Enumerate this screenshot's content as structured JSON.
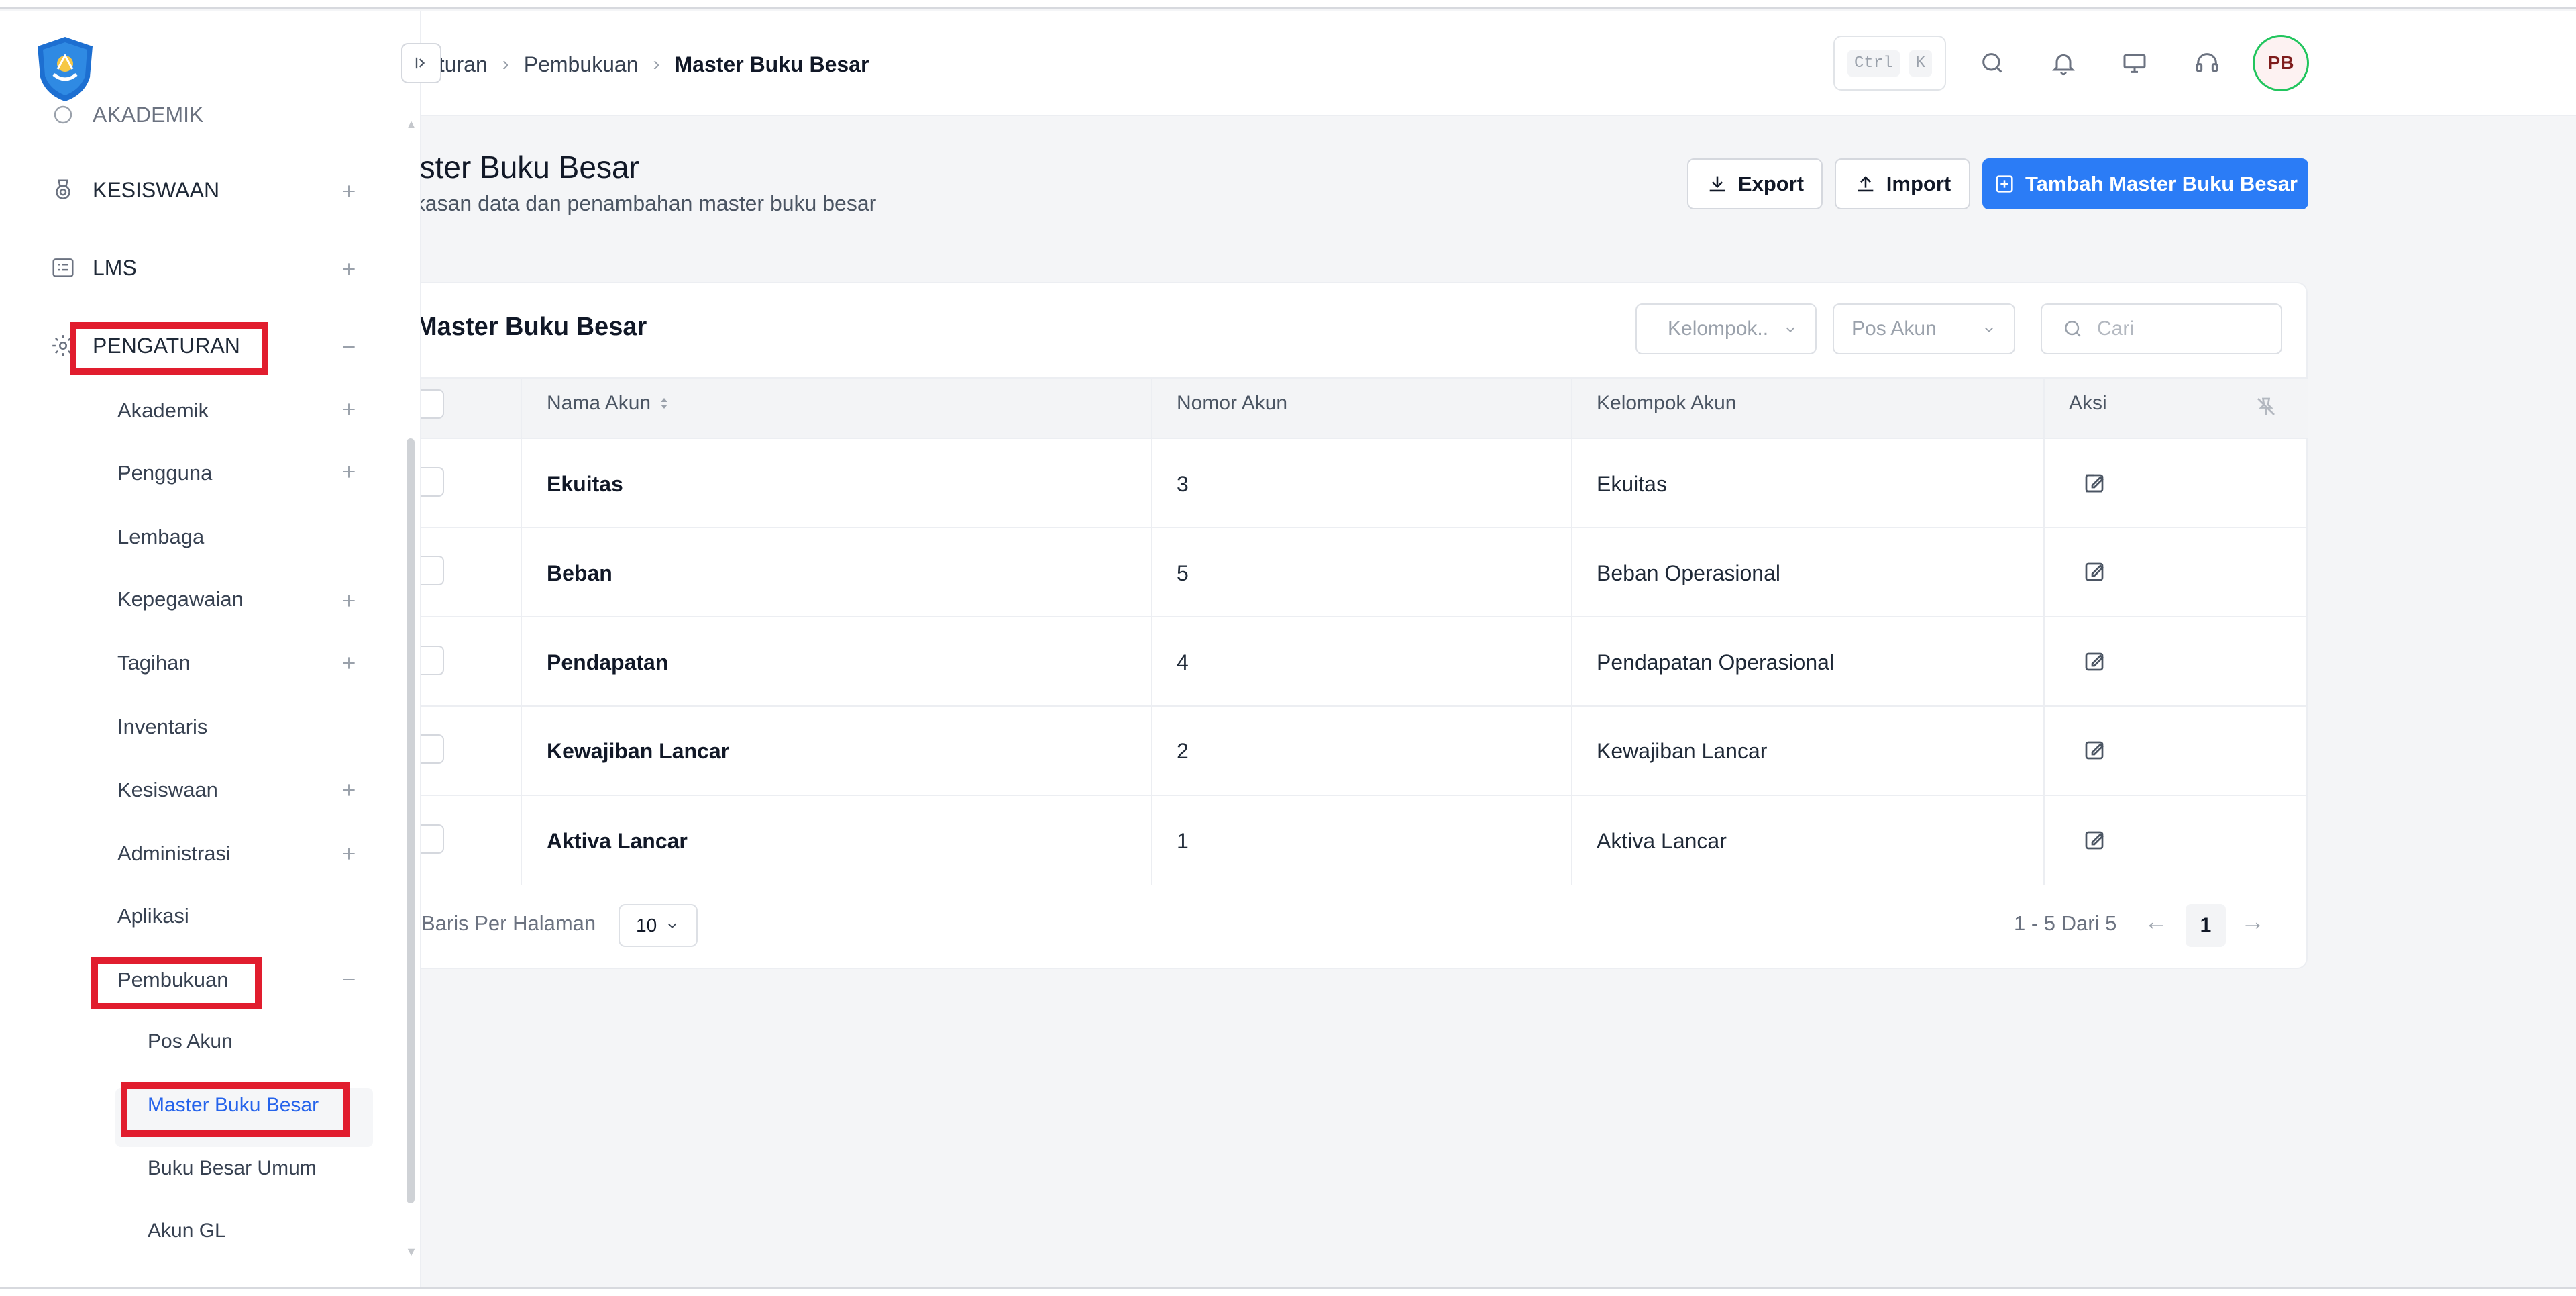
{
  "breadcrumb": {
    "item1": "aturan",
    "item2": "Pembukuan",
    "current": "Master Buku Besar"
  },
  "header": {
    "kbd_ctrl": "Ctrl",
    "kbd_k": "K",
    "avatar_initials": "PB"
  },
  "sidebar": {
    "akademik_partial": "AKADEMIK",
    "kesiswaan": "KESISWAAN",
    "lms": "LMS",
    "pengaturan": "PENGATURAN",
    "sub": {
      "akademik": "Akademik",
      "pengguna": "Pengguna",
      "lembaga": "Lembaga",
      "kepegawaian": "Kepegawaian",
      "tagihan": "Tagihan",
      "inventaris": "Inventaris",
      "kesiswaan": "Kesiswaan",
      "administrasi": "Administrasi",
      "aplikasi": "Aplikasi",
      "pembukuan": "Pembukuan"
    },
    "pembukuan_items": {
      "pos_akun": "Pos Akun",
      "master_buku_besar": "Master Buku Besar",
      "buku_besar_umum": "Buku Besar Umum",
      "akun_gl": "Akun GL"
    }
  },
  "page": {
    "title": "aster Buku Besar",
    "subtitle": "gkasan data dan penambahan master buku besar",
    "export_label": "Export",
    "import_label": "Import",
    "add_label": "Tambah Master Buku Besar"
  },
  "card": {
    "title": "Master Buku Besar",
    "filter_kelompok": "Kelompok..",
    "filter_pos": "Pos Akun",
    "search_placeholder": "Cari"
  },
  "table": {
    "headers": {
      "nama": "Nama Akun",
      "nomor": "Nomor Akun",
      "kelompok": "Kelompok Akun",
      "aksi": "Aksi"
    },
    "rows": [
      {
        "nama": "Ekuitas",
        "nomor": "3",
        "kelompok": "Ekuitas"
      },
      {
        "nama": "Beban",
        "nomor": "5",
        "kelompok": "Beban Operasional"
      },
      {
        "nama": "Pendapatan",
        "nomor": "4",
        "kelompok": "Pendapatan Operasional"
      },
      {
        "nama": "Kewajiban Lancar",
        "nomor": "2",
        "kelompok": "Kewajiban Lancar"
      },
      {
        "nama": "Aktiva Lancar",
        "nomor": "1",
        "kelompok": "Aktiva Lancar"
      }
    ]
  },
  "pagination": {
    "per_page_label": "Baris Per Halaman",
    "per_page_value": "10",
    "range": "1 - 5 Dari 5",
    "current_page": "1"
  },
  "colors": {
    "primary": "#2b7cf6",
    "highlight": "#e11d2e",
    "active_text": "#2563eb",
    "avatar_ring": "#22c55e"
  }
}
